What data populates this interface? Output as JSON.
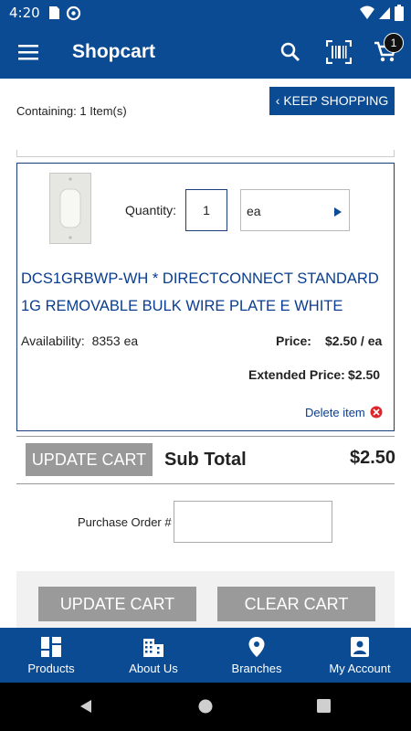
{
  "status_bar": {
    "time": "4:20"
  },
  "app_bar": {
    "title": "Shopcart",
    "cart_count": "1",
    "icons": [
      "menu-icon",
      "search-icon",
      "barcode-scan-icon",
      "cart-icon"
    ]
  },
  "summary": {
    "containing_label": "Containing:",
    "containing_value": "1 Item(s)",
    "keep_shopping": "‹ KEEP SHOPPING"
  },
  "item": {
    "quantity_label": "Quantity:",
    "quantity_value": "1",
    "unit_value": "ea",
    "name": "DCS1GRBWP-WH * DIRECTCONNECT STANDARD 1G REMOVABLE BULK WIRE PLATE E WHITE",
    "availability_label": "Availability:",
    "availability_value": "8353 ea",
    "price_label": "Price:",
    "price_value": "$2.50 / ea",
    "extended_price_label": "Extended Price:",
    "extended_price_value": "$2.50",
    "delete_label": "Delete item"
  },
  "subtotal": {
    "update_cart": "UPDATE CART",
    "label": "Sub Total",
    "value": "$2.50"
  },
  "purchase_order": {
    "label": "Purchase Order #",
    "value": ""
  },
  "actions": {
    "update_cart": "UPDATE CART",
    "clear_cart": "CLEAR CART"
  },
  "bottom_nav": [
    {
      "label": "Products",
      "icon": "products-grid-icon"
    },
    {
      "label": "About Us",
      "icon": "building-icon"
    },
    {
      "label": "Branches",
      "icon": "location-pin-icon"
    },
    {
      "label": "My Account",
      "icon": "account-icon"
    }
  ],
  "colors": {
    "brand": "#0a4b93",
    "button_gray": "#9a9a9a",
    "link": "#0a3d8f",
    "delete_red": "#e0242b"
  }
}
